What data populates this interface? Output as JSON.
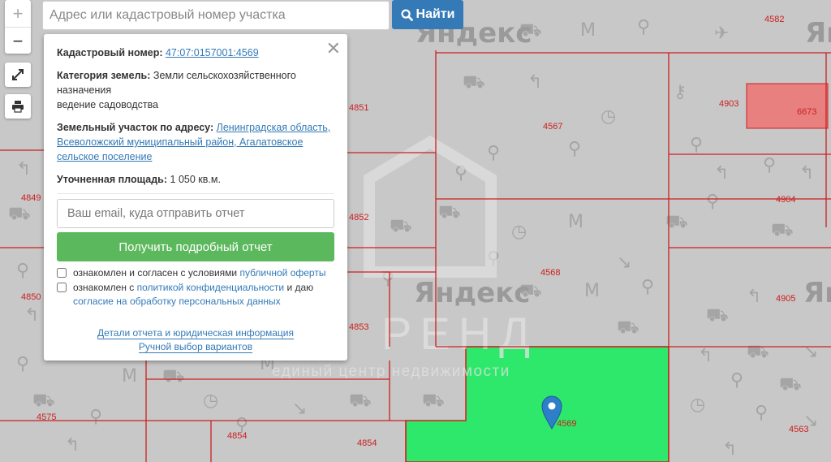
{
  "search": {
    "placeholder": "Адрес или кадастровый номер участка",
    "button_label": "Найти"
  },
  "map_controls": {
    "zoom_in": "+",
    "zoom_out": "−"
  },
  "map": {
    "provider_label": "Яндекс",
    "watermark_title": "РЕНД",
    "watermark_subtitle": "единый центр недвижимости",
    "parcel_numbers": [
      "4582",
      "4903",
      "6673",
      "4851",
      "4567",
      "4849",
      "4904",
      "4852",
      "4568",
      "4850",
      "4905",
      "4853",
      "4575",
      "4854",
      "4854",
      "4569",
      "4563"
    ],
    "colors": {
      "selected_parcel": "#2ee86b",
      "highlight_parcel": "#e88080",
      "boundary": "#cc2020",
      "marker": "#2d7fc8"
    }
  },
  "popup": {
    "close_icon": "close-icon",
    "cadastral_label": "Кадастровый номер:",
    "cadastral_value": "47:07:0157001:4569",
    "category_label": "Категория земель:",
    "category_value": "Земли сельскохозяйственного назначения",
    "usage_value": "ведение садоводства",
    "address_label": "Земельный участок по адресу:",
    "address_value": "Ленинградская область, Всеволожский муниципальный район, Агалатовское сельское поселение",
    "area_label": "Уточненная площадь:",
    "area_value": "1 050 кв.м.",
    "email_placeholder": "Ваш email, куда отправить отчет",
    "report_button": "Получить подробный отчет",
    "check1_prefix": "ознакомлен и согласен с условиями",
    "check1_link": "публичной оферты",
    "check2_prefix": "ознакомлен с",
    "check2_link": "политикой конфиденциальности",
    "check2_mid": "и даю",
    "check2_link2": "согласие на обработку персональных данных",
    "details_link": "Детали отчета и юридическая информация",
    "manual_link": "Ручной выбор вариантов"
  }
}
